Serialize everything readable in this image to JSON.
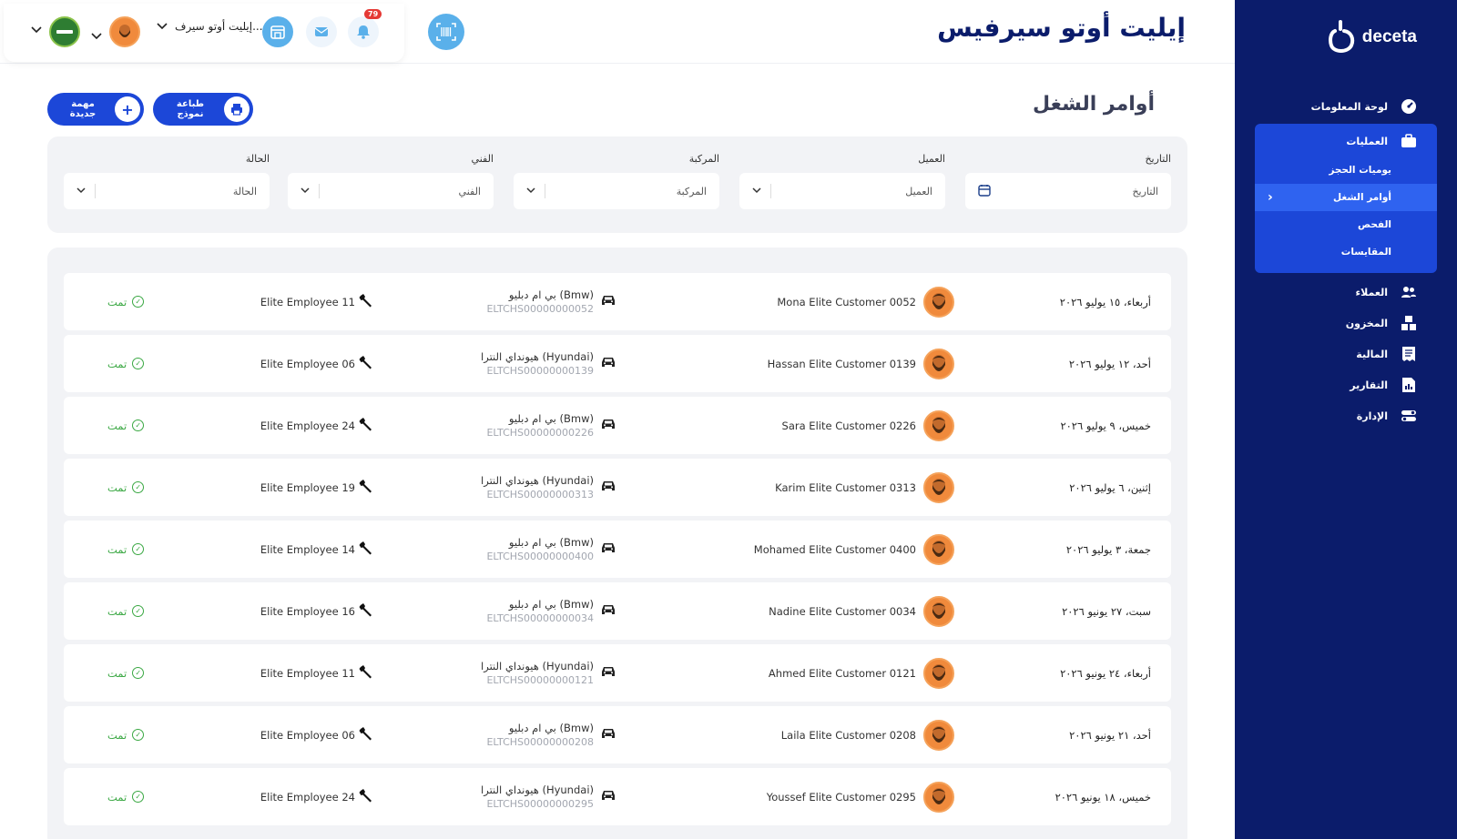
{
  "header": {
    "brand_title": "إيليت أوتو سيرفيس",
    "company_selector": "إيليت أوتو سيرف...",
    "notifications_count": "79"
  },
  "sidebar": {
    "logo_text": "deceta",
    "items": [
      {
        "label": "لوحة المعلومات",
        "icon": "dashboard-icon"
      },
      {
        "label": "العمليات",
        "icon": "briefcase-icon"
      },
      {
        "label": "العملاء",
        "icon": "users-icon"
      },
      {
        "label": "المخزون",
        "icon": "boxes-icon"
      },
      {
        "label": "المالية",
        "icon": "receipt-icon"
      },
      {
        "label": "التقارير",
        "icon": "report-icon"
      },
      {
        "label": "الإدارة",
        "icon": "toggle-icon"
      }
    ],
    "operations_sub": [
      {
        "label": "يوميات الحجز"
      },
      {
        "label": "أوامر الشغل"
      },
      {
        "label": "الفحص"
      },
      {
        "label": "المقايسات"
      }
    ]
  },
  "page": {
    "title": "أوامر الشغل",
    "print_button": "طباعة نموذج",
    "new_task_button": "مهمة جديدة"
  },
  "filters": {
    "date": {
      "label": "التاريخ",
      "placeholder": "التاريخ"
    },
    "customer": {
      "label": "العميل",
      "placeholder": "العميل"
    },
    "vehicle": {
      "label": "المركبة",
      "placeholder": "المركبة"
    },
    "technician": {
      "label": "الفني",
      "placeholder": "الفني"
    },
    "status": {
      "label": "الحالة",
      "placeholder": "الحالة"
    }
  },
  "rows": [
    {
      "date": "أربعاء، ١٥ يوليو ٢٠٢٦",
      "customer": "Mona Elite Customer 0052",
      "vehicle": "بي ام دبليو (Bmw)",
      "plate": "ELTCHS00000000052",
      "technician": "Elite Employee 11",
      "status": "تمت"
    },
    {
      "date": "أحد، ١٢ يوليو ٢٠٢٦",
      "customer": "Hassan Elite Customer 0139",
      "vehicle": "هيونداي النترا (Hyundai)",
      "plate": "ELTCHS00000000139",
      "technician": "Elite Employee 06",
      "status": "تمت"
    },
    {
      "date": "خميس، ٩ يوليو ٢٠٢٦",
      "customer": "Sara Elite Customer 0226",
      "vehicle": "بي ام دبليو (Bmw)",
      "plate": "ELTCHS00000000226",
      "technician": "Elite Employee 24",
      "status": "تمت"
    },
    {
      "date": "إثنين، ٦ يوليو ٢٠٢٦",
      "customer": "Karim Elite Customer 0313",
      "vehicle": "هيونداي النترا (Hyundai)",
      "plate": "ELTCHS00000000313",
      "technician": "Elite Employee 19",
      "status": "تمت"
    },
    {
      "date": "جمعة، ٣ يوليو ٢٠٢٦",
      "customer": "Mohamed Elite Customer 0400",
      "vehicle": "بي ام دبليو (Bmw)",
      "plate": "ELTCHS00000000400",
      "technician": "Elite Employee 14",
      "status": "تمت"
    },
    {
      "date": "سبت، ٢٧ يونيو ٢٠٢٦",
      "customer": "Nadine Elite Customer 0034",
      "vehicle": "بي ام دبليو (Bmw)",
      "plate": "ELTCHS00000000034",
      "technician": "Elite Employee 16",
      "status": "تمت"
    },
    {
      "date": "أربعاء، ٢٤ يونيو ٢٠٢٦",
      "customer": "Ahmed Elite Customer 0121",
      "vehicle": "هيونداي النترا (Hyundai)",
      "plate": "ELTCHS00000000121",
      "technician": "Elite Employee 11",
      "status": "تمت"
    },
    {
      "date": "أحد، ٢١ يونيو ٢٠٢٦",
      "customer": "Laila Elite Customer 0208",
      "vehicle": "بي ام دبليو (Bmw)",
      "plate": "ELTCHS00000000208",
      "technician": "Elite Employee 06",
      "status": "تمت"
    },
    {
      "date": "خميس، ١٨ يونيو ٢٠٢٦",
      "customer": "Youssef Elite Customer 0295",
      "vehicle": "هيونداي النترا (Hyundai)",
      "plate": "ELTCHS00000000295",
      "technician": "Elite Employee 24",
      "status": "تمت"
    }
  ],
  "colors": {
    "sidebar_bg": "#0b1c6b",
    "accent": "#1c47d8",
    "status_done": "#3aa843"
  }
}
